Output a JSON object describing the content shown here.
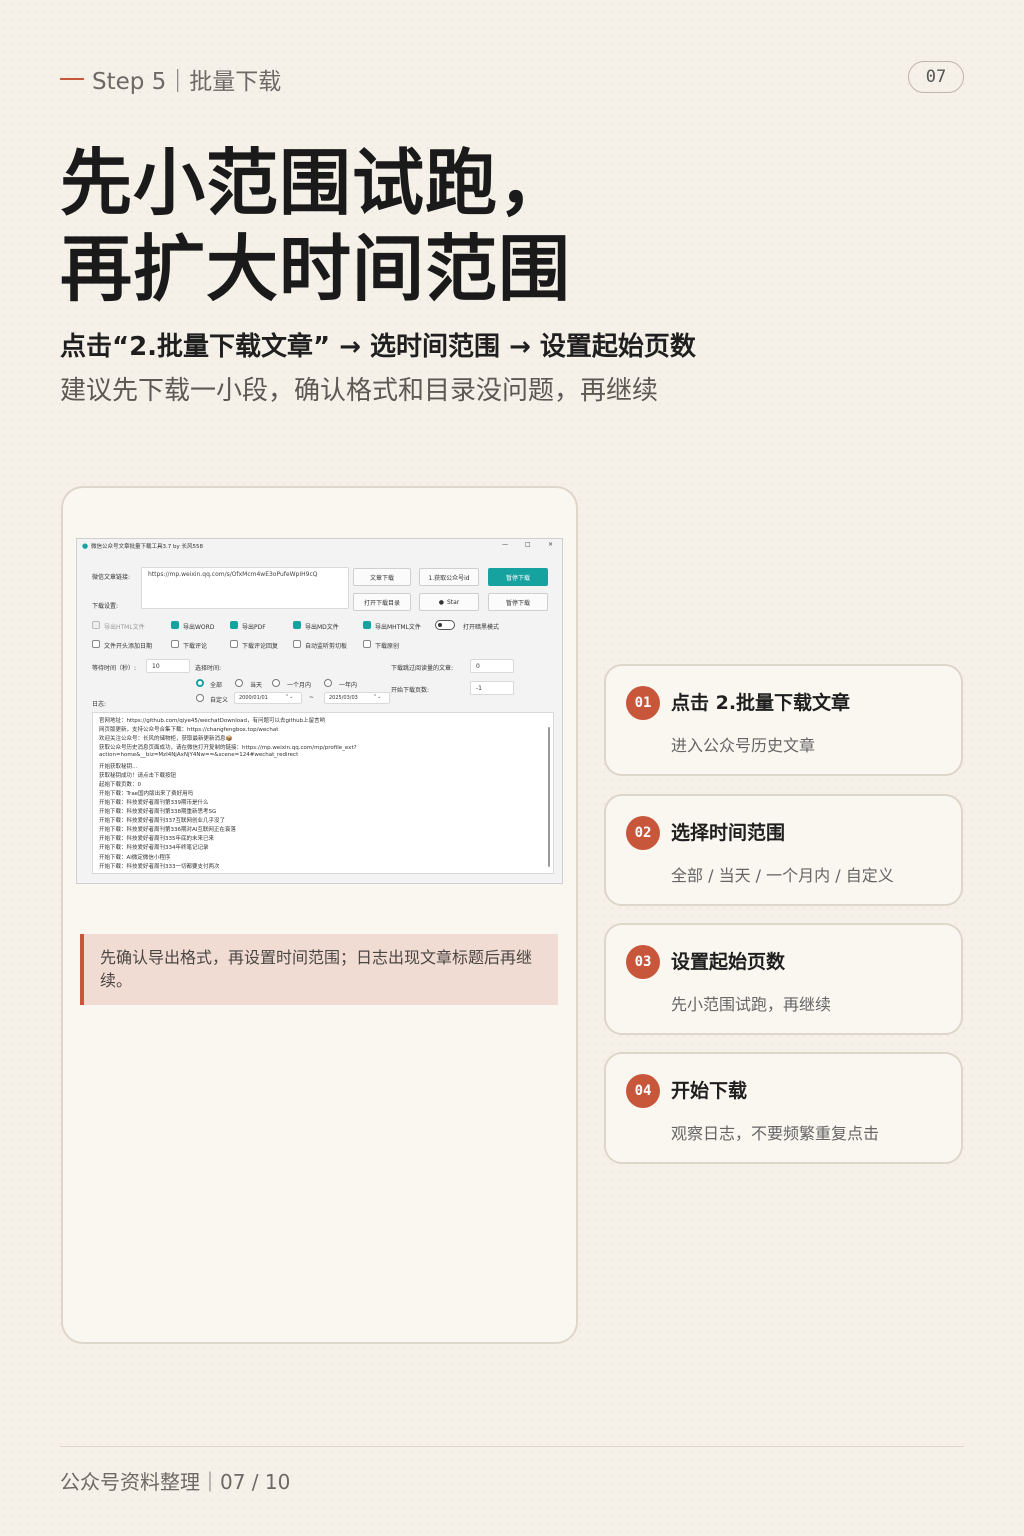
{
  "header": {
    "step_label": "Step 5｜批量下载",
    "page_number": "07"
  },
  "title": {
    "line1": "先小范围试跑，",
    "line2": "再扩大时间范围"
  },
  "flow_text": "点击“2.批量下载文章” → 选时间范围 → 设置起始页数",
  "advice_text": "建议先下载一小段，确认格式和目录没问题，再继续",
  "screenshot": {
    "window_title": "微信公众号文章批量下载工具3.7 by 长风558",
    "window_controls": [
      "—",
      "□",
      "×"
    ],
    "url_label": "微信文章链接:",
    "url_value": "https://mp.weixin.qq.com/s/OfxMcm4wE3oPufeWpIH9cQ",
    "download_settings_label": "下载设置:",
    "buttons": {
      "article_download": "文章下载",
      "get_account_id": "1.获取公众号id",
      "pause_download_primary": "暂停下载",
      "open_download_dir": "打开下载目录",
      "star": "Star",
      "pause_download": "暂停下载"
    },
    "export_options": [
      {
        "label": "导出HTML文件",
        "state": "disabled"
      },
      {
        "label": "导出WORD",
        "state": "checked"
      },
      {
        "label": "导出PDF",
        "state": "checked"
      },
      {
        "label": "导出MD文件",
        "state": "checked"
      },
      {
        "label": "导出MHTML文件",
        "state": "checked"
      }
    ],
    "dark_mode_label": "打开暗黑模式",
    "more_options": [
      {
        "label": "文件开头添加日期",
        "state": "unchecked"
      },
      {
        "label": "下载评论",
        "state": "unchecked"
      },
      {
        "label": "下载评论回复",
        "state": "unchecked"
      },
      {
        "label": "自动监听剪切板",
        "state": "unchecked"
      },
      {
        "label": "下载原创",
        "state": "unchecked"
      }
    ],
    "wait_time_label": "等待时间（秒）:",
    "wait_time_value": "10",
    "select_time_label": "选择时间:",
    "time_options": [
      {
        "label": "全部",
        "selected": true
      },
      {
        "label": "当天",
        "selected": false
      },
      {
        "label": "一个月内",
        "selected": false
      },
      {
        "label": "一年内",
        "selected": false
      },
      {
        "label": "自定义",
        "selected": false
      }
    ],
    "date_from": "2000/01/01",
    "date_sep": "~",
    "date_to": "2025/03/03",
    "skip_read_label": "下载跳过阅读量的文章:",
    "skip_read_value": "0",
    "start_page_label": "开始下载页数:",
    "start_page_value": "-1",
    "log_label": "日志:",
    "log_lines": [
      "官网地址：https://github.com/qiye45/wechatDownload，有问题可以去github上留言哟",
      "网页版更新，支持公众号合集下载：https://changfengbox.top/wechat",
      "欢迎关注公众号：长风的储物柜，获取最新更新消息📦",
      "获取公众号历史消息页面成功，请在微信打开复制的链接：https://mp.weixin.qq.com/mp/profile_ext?",
      "action=home&__biz=MzI4NjAxNjY4Nw==&scene=124#wechat_redirect",
      "开始获取秘钥...",
      "获取秘钥成功！请点击下载按钮",
      "起始下载页数：0",
      "开始下载：Trae国内版出来了费好用吗",
      "开始下载：科技爱好者周刊第339期币是什么",
      "开始下载：科技爱好者周刊第338期重新思考SG",
      "开始下载：科技爱好者周刊337互联网创业几乎没了",
      "开始下载：科技爱好者周刊第336期对AI互联网正在衰落",
      "开始下载：科技爱好者周刊335年底的未来已来",
      "开始下载：科技爱好者周刊334年终笔记记录",
      "开始下载：AI微定微信小程序",
      "开始下载：科技爱好者周刊333一切都要支付两次"
    ]
  },
  "note_text": "先确认导出格式，再设置时间范围；日志出现文章标题后再继续。",
  "steps": [
    {
      "num": "01",
      "title": "点击 2.批量下载文章",
      "desc": "进入公众号历史文章"
    },
    {
      "num": "02",
      "title": "选择时间范围",
      "desc": "全部 / 当天 / 一个月内 / 自定义"
    },
    {
      "num": "03",
      "title": "设置起始页数",
      "desc": "先小范围试跑，再继续"
    },
    {
      "num": "04",
      "title": "开始下载",
      "desc": "观察日志，不要频繁重复点击"
    }
  ],
  "footer": "公众号资料整理｜07 / 10",
  "colors": {
    "accent": "#c8563a",
    "background": "#f5f1e9",
    "app_primary": "#16a3a0"
  }
}
